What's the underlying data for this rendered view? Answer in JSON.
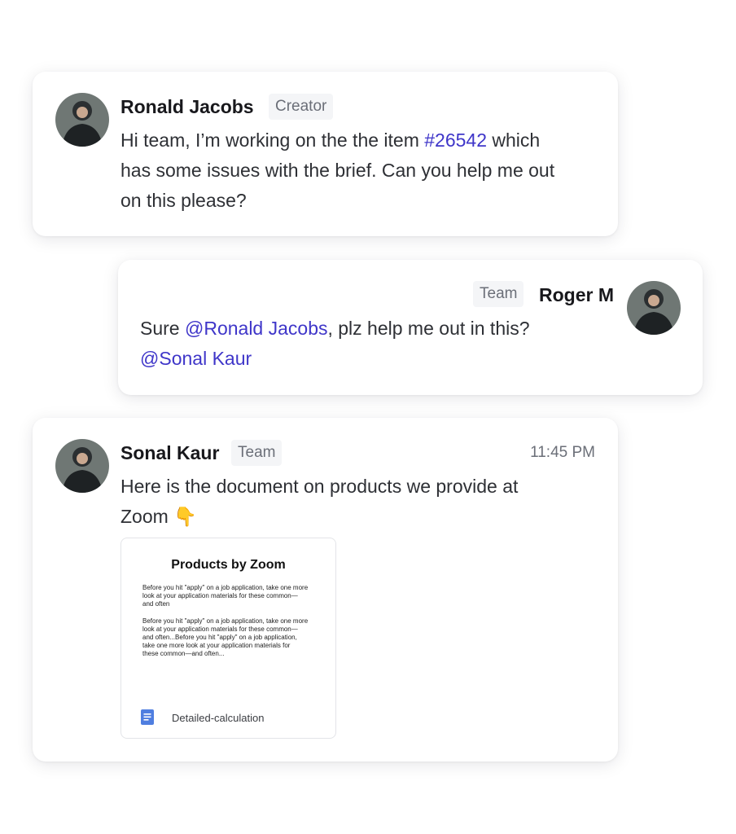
{
  "messages": [
    {
      "author": "Ronald Jacobs",
      "role": "Creator",
      "avatar": "avatar-person-hoodie",
      "text_parts": [
        "Hi team, I’m working on the the item ",
        "#26542",
        " which",
        "has some issues with the brief. Can you help me out",
        "on this please?"
      ]
    },
    {
      "author": "Roger M",
      "role": "Team",
      "avatar": "avatar-person-hoodie",
      "text_parts": [
        "Sure ",
        "@Ronald Jacobs",
        ", plz help me out in this?",
        "@Sonal Kaur"
      ]
    },
    {
      "author": "Sonal Kaur",
      "role": "Team",
      "time": "11:45 PM",
      "avatar": "avatar-person-hoodie",
      "text_parts": [
        "Here is the document on products we provide at",
        "Zoom",
        "👇"
      ],
      "attachment": {
        "title": "Products by Zoom",
        "paragraph1_lines": [
          "Before you hit \"apply\" on a job application, take one more",
          "look at your application materials for these common—",
          "and often"
        ],
        "paragraph2_lines": [
          "Before you hit \"apply\" on a job application, take one more",
          "look at your application materials for these common—",
          "and often...Before you hit \"apply\" on a job application,",
          "take one more look at your application materials for",
          "these common—and often..."
        ],
        "file_name": "Detailed-calculation",
        "file_icon": "google-doc-icon",
        "icon_color": "#4f7ee0"
      }
    }
  ],
  "colors": {
    "link": "#3f36c9",
    "badge_bg": "#f4f5f7"
  }
}
